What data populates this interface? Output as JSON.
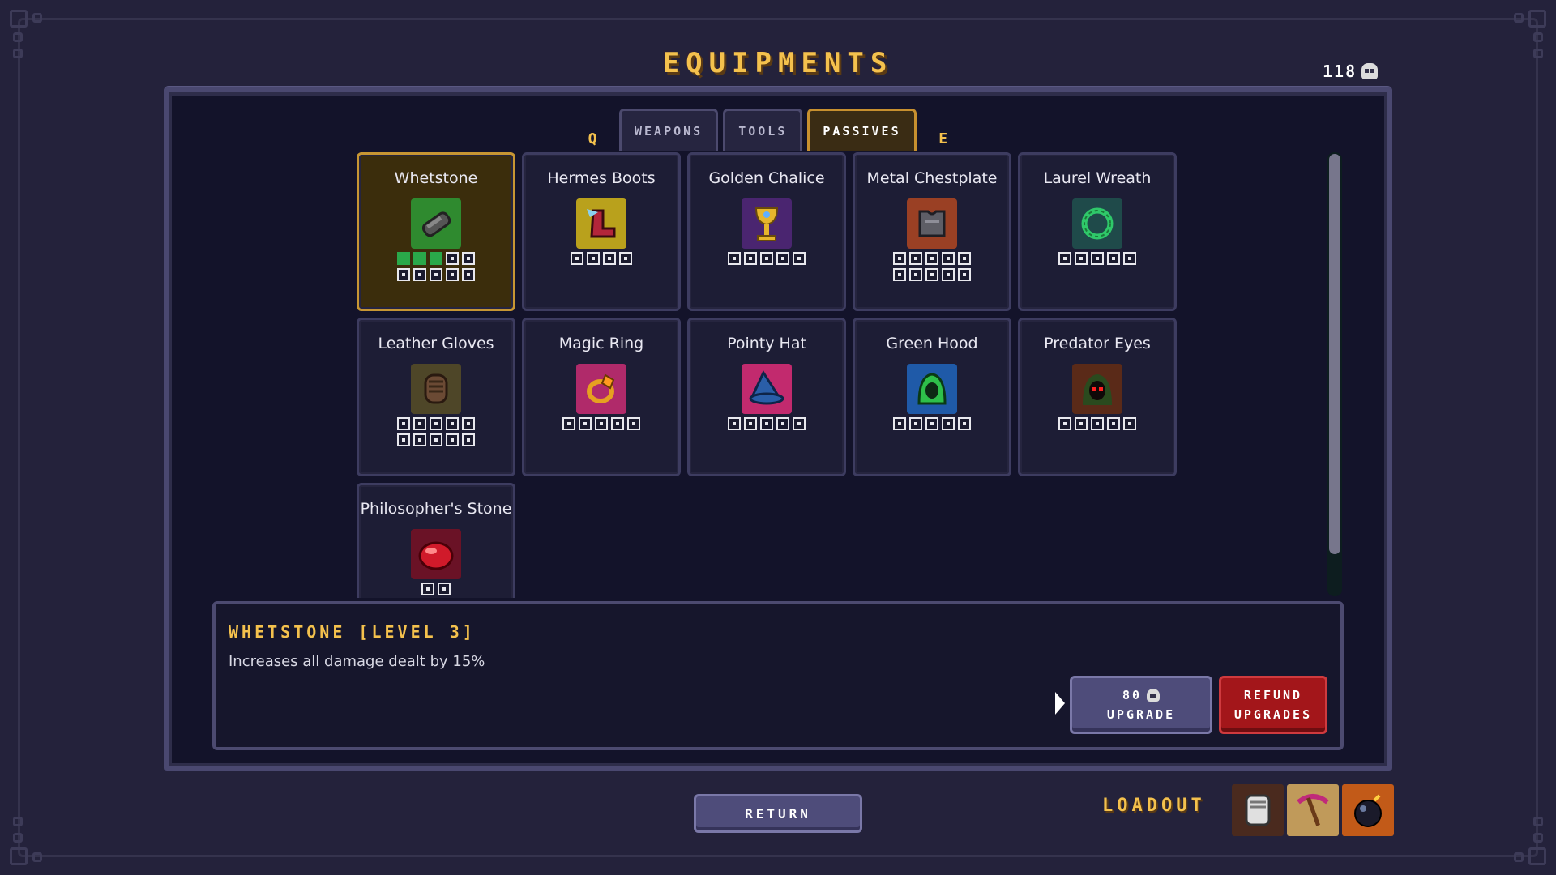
{
  "header": {
    "title": "EQUIPMENTS",
    "currency": "118",
    "currency_icon": "skull-icon"
  },
  "tabs": {
    "prev_key": "Q",
    "next_key": "E",
    "items": [
      {
        "label": "WEAPONS",
        "active": false
      },
      {
        "label": "TOOLS",
        "active": false
      },
      {
        "label": "PASSIVES",
        "active": true
      }
    ]
  },
  "items": [
    {
      "name": "Whetstone",
      "icon": "whetstone-icon",
      "filled": 3,
      "total": 10,
      "selected": true
    },
    {
      "name": "Hermes Boots",
      "icon": "winged-boot-icon",
      "filled": 0,
      "total": 4
    },
    {
      "name": "Golden Chalice",
      "icon": "chalice-icon",
      "filled": 0,
      "total": 5
    },
    {
      "name": "Metal Chestplate",
      "icon": "chestplate-icon",
      "filled": 0,
      "total": 10
    },
    {
      "name": "Laurel Wreath",
      "icon": "laurel-wreath-icon",
      "filled": 0,
      "total": 5
    },
    {
      "name": "Leather Gloves",
      "icon": "glove-icon",
      "filled": 0,
      "total": 10
    },
    {
      "name": "Magic Ring",
      "icon": "ring-icon",
      "filled": 0,
      "total": 5
    },
    {
      "name": "Pointy Hat",
      "icon": "wizard-hat-icon",
      "filled": 0,
      "total": 5
    },
    {
      "name": "Green Hood",
      "icon": "hood-icon",
      "filled": 0,
      "total": 5
    },
    {
      "name": "Predator Eyes",
      "icon": "predator-eyes-icon",
      "filled": 0,
      "total": 5
    },
    {
      "name": "Philosopher's Stone",
      "icon": "red-gem-icon",
      "filled": 0,
      "total": 2
    }
  ],
  "description": {
    "title": "WHETSTONE [LEVEL 3]",
    "text": "Increases all damage dealt by 15%"
  },
  "buttons": {
    "upgrade_cost": "80",
    "upgrade_label": "UPGRADE",
    "refund_line1": "REFUND",
    "refund_line2": "UPGRADES",
    "return_label": "RETURN"
  },
  "loadout": {
    "label": "LOADOUT",
    "slots": [
      "gauntlet-icon",
      "pickaxe-icon",
      "bomb-icon"
    ]
  },
  "colors": {
    "accent": "#f4c14d",
    "pip_filled": "#2aa84a",
    "refund": "#a3161a"
  }
}
